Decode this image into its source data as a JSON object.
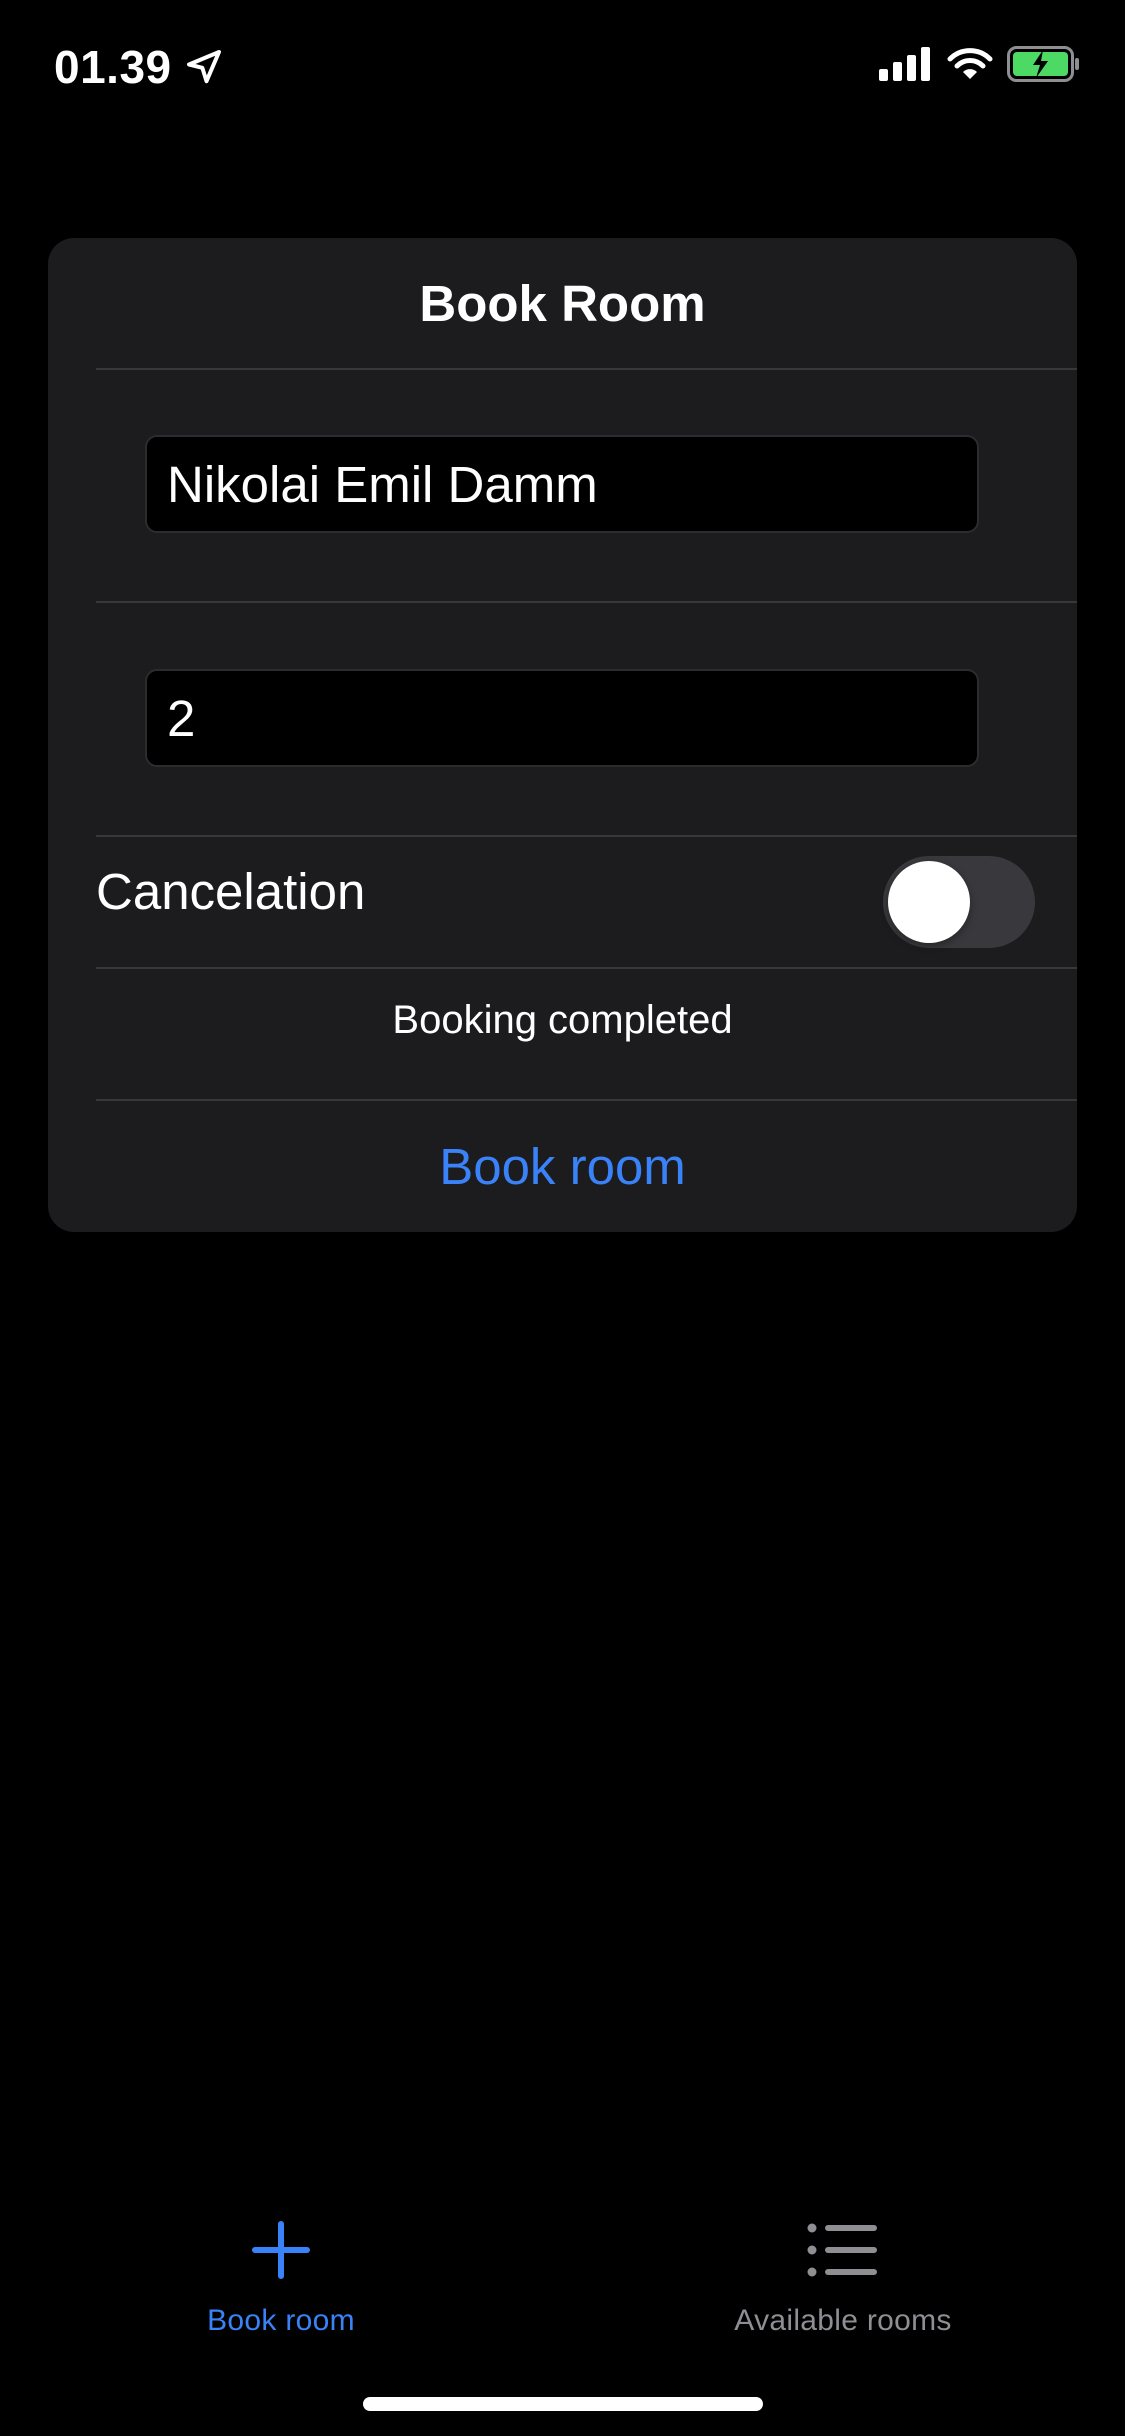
{
  "status_bar": {
    "time": "01.39",
    "icons": [
      "location-arrow-icon",
      "cellular-signal-icon",
      "wifi-icon",
      "battery-charging-icon"
    ],
    "battery_color": "#4cd964"
  },
  "form": {
    "title": "Book Room",
    "name_value": "Nikolai Emil Damm",
    "guests_value": "2",
    "cancelation_label": "Cancelation",
    "cancelation_on": false,
    "status_message": "Booking completed",
    "book_button_label": "Book room"
  },
  "tab_bar": {
    "tabs": [
      {
        "label": "Book room",
        "icon": "plus-icon",
        "active": true
      },
      {
        "label": "Available rooms",
        "icon": "list-icon",
        "active": false
      }
    ]
  },
  "colors": {
    "accent": "#3a82f7",
    "card_background": "#1c1c1e",
    "inactive_tab": "#8e8e93"
  }
}
